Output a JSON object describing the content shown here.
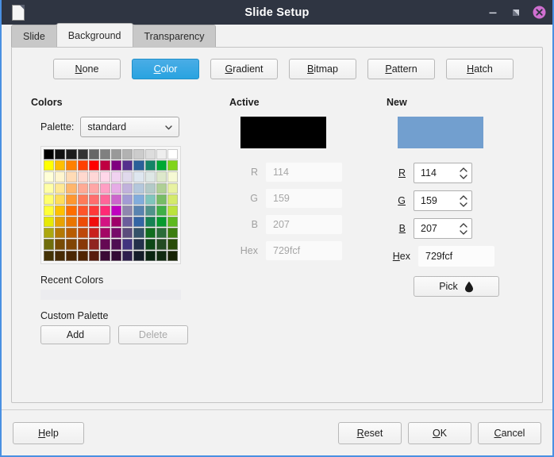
{
  "window": {
    "title": "Slide Setup",
    "doc_icon": "document-icon",
    "controls": [
      {
        "name": "minimize-button",
        "icon": "minimize-icon"
      },
      {
        "name": "maximize-button",
        "icon": "restore-icon"
      },
      {
        "name": "close-button",
        "icon": "close-icon",
        "color": "#d06cd0"
      }
    ],
    "titlebar_bg": "#2f3542",
    "frame_accent": "#4a90e2"
  },
  "tabs": [
    {
      "label": "Slide",
      "active": false
    },
    {
      "label": "Background",
      "active": true
    },
    {
      "label": "Transparency",
      "active": false
    }
  ],
  "fill_types": [
    {
      "label": "None",
      "accel": "N",
      "selected": false
    },
    {
      "label": "Color",
      "accel": "C",
      "selected": true
    },
    {
      "label": "Gradient",
      "accel": "G",
      "selected": false
    },
    {
      "label": "Bitmap",
      "accel": "B",
      "selected": false
    },
    {
      "label": "Pattern",
      "accel": "P",
      "selected": false
    },
    {
      "label": "Hatch",
      "accel": "H",
      "selected": false
    }
  ],
  "colors_section": {
    "header": "Colors",
    "palette_label": "Palette:",
    "palette_value": "standard",
    "recent_header": "Recent Colors",
    "recent_swatches": [],
    "custom_header": "Custom Palette",
    "add_label": "Add",
    "add_accel": "A",
    "delete_label": "Delete",
    "delete_disabled": true,
    "grid_columns": 12,
    "grid_rows": 10,
    "swatches": [
      "#000000",
      "#111111",
      "#1c1c1c",
      "#333333",
      "#666666",
      "#808080",
      "#999999",
      "#b2b2b2",
      "#cccccc",
      "#dddddd",
      "#eeeeee",
      "#ffffff",
      "#ffff00",
      "#ffbf00",
      "#ff8000",
      "#ff4000",
      "#ff0000",
      "#bf0041",
      "#800080",
      "#55308d",
      "#2a6099",
      "#158466",
      "#00a933",
      "#81d41a",
      "#ffffd7",
      "#fff5ce",
      "#ffdbb6",
      "#ffd8ce",
      "#ffd7d7",
      "#ffd7e9",
      "#f0d2f0",
      "#e0d9ec",
      "#dee6ef",
      "#dee7e5",
      "#dde8cb",
      "#f6f9d4",
      "#ffffa6",
      "#ffe994",
      "#ffb66c",
      "#ffaa95",
      "#ffa6a6",
      "#ff9fc4",
      "#e6ace6",
      "#c1b2dc",
      "#b4c7dc",
      "#b3cac7",
      "#afd095",
      "#e8f2a1",
      "#ffff6d",
      "#ffde59",
      "#ff972f",
      "#ff7b59",
      "#ff6d6d",
      "#ff6699",
      "#cc66cc",
      "#a29bd4",
      "#81acdc",
      "#80c5bc",
      "#77bc65",
      "#d4ea6b",
      "#ffff38",
      "#ffc000",
      "#ff6d00",
      "#ff5429",
      "#ff3838",
      "#ff2975",
      "#bf00bf",
      "#8e86ae",
      "#5983b0",
      "#50938a",
      "#3faf46",
      "#bbe33d",
      "#e6e905",
      "#e8a202",
      "#ea7500",
      "#ed4c05",
      "#f10d0c",
      "#d31282",
      "#9e0069",
      "#6b5e9b",
      "#3465a4",
      "#168253",
      "#069a2e",
      "#5eb91e",
      "#aca80f",
      "#b47804",
      "#b85c00",
      "#be480a",
      "#c9211e",
      "#a30664",
      "#770b6a",
      "#5b4d7c",
      "#355269",
      "#126e1f",
      "#2a6c39",
      "#3b7d0f",
      "#706e0c",
      "#784b04",
      "#814504",
      "#883808",
      "#90231f",
      "#650953",
      "#4e0d52",
      "#41347e",
      "#23314b",
      "#0d4717",
      "#224b22",
      "#294d09",
      "#443205",
      "#472a05",
      "#4b2604",
      "#502300",
      "#591c0f",
      "#3b0a35",
      "#320a34",
      "#2e1f4e",
      "#141c29",
      "#0a2411",
      "#112b11",
      "#182506"
    ]
  },
  "active_section": {
    "header": "Active",
    "preview_color": "#000000",
    "fields": [
      {
        "label": "R",
        "value": "114"
      },
      {
        "label": "G",
        "value": "159"
      },
      {
        "label": "B",
        "value": "207"
      }
    ],
    "hex_label": "Hex",
    "hex_value": "729fcf",
    "disabled": true
  },
  "new_section": {
    "header": "New",
    "preview_color": "#729fcf",
    "fields": [
      {
        "label": "R",
        "accel": "R",
        "value": "114"
      },
      {
        "label": "G",
        "accel": "G",
        "value": "159"
      },
      {
        "label": "B",
        "accel": "B",
        "value": "207"
      }
    ],
    "hex_label": "Hex",
    "hex_accel": "H",
    "hex_value": "729fcf",
    "pick_label": "Pick",
    "pick_icon": "eyedropper-droplet-icon"
  },
  "bottom_bar": {
    "help": {
      "label": "Help",
      "accel": "H"
    },
    "reset": {
      "label": "Reset",
      "accel": "R"
    },
    "ok": {
      "label": "OK",
      "accel": "O"
    },
    "cancel": {
      "label": "Cancel",
      "accel": "C"
    }
  }
}
